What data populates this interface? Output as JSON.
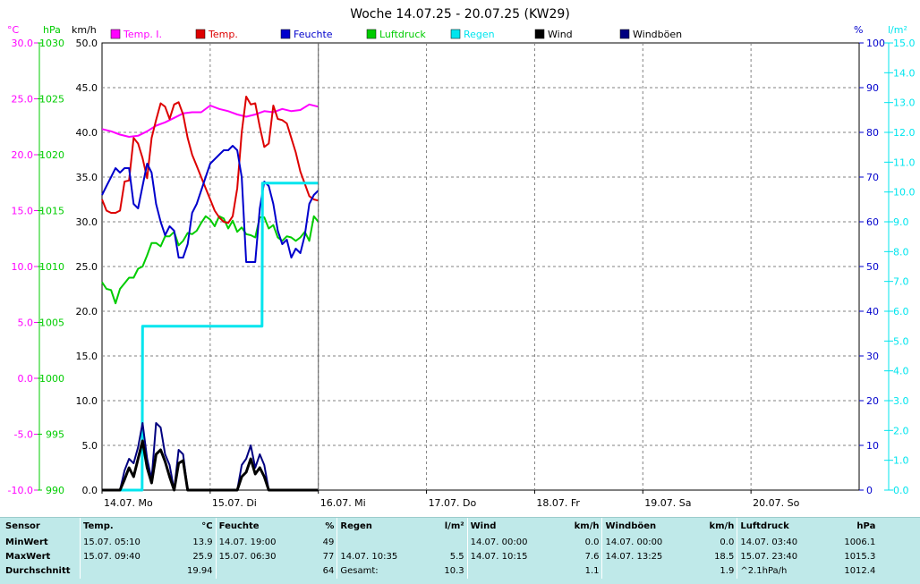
{
  "title": "Woche 14.07.25 - 20.07.25 (KW29)",
  "colors": {
    "temp_i": "#ff00ff",
    "temp": "#dd0000",
    "feuchte": "#0000cc",
    "luftdruck": "#00cc00",
    "regen": "#00e5ee",
    "wind": "#000000",
    "windboeen": "#000080",
    "grid": "#808080",
    "stats_bg": "#bfe9e9"
  },
  "chart_data": {
    "type": "line",
    "title": "Woche 14.07.25 - 20.07.25 (KW29)",
    "x_unit": "hours since 14.07. 00:00",
    "xlim": [
      0,
      168
    ],
    "x_ticks": [
      {
        "x": 0,
        "label": "14.07. Mo"
      },
      {
        "x": 24,
        "label": "15.07. Di"
      },
      {
        "x": 48,
        "label": "16.07. Mi"
      },
      {
        "x": 72,
        "label": "17.07. Do"
      },
      {
        "x": 96,
        "label": "18.07. Fr"
      },
      {
        "x": 120,
        "label": "19.07. Sa"
      },
      {
        "x": 144,
        "label": "20.07. So"
      }
    ],
    "axes": {
      "temp": {
        "unit": "°C",
        "range": [
          -10,
          30
        ],
        "ticks": [
          "-10.0",
          "-5.0",
          "0.0",
          "5.0",
          "10.0",
          "15.0",
          "20.0",
          "25.0",
          "30.0"
        ]
      },
      "pressure": {
        "unit": "hPa",
        "range": [
          990,
          1030
        ],
        "ticks": [
          "990",
          "995",
          "1000",
          "1005",
          "1010",
          "1015",
          "1020",
          "1025",
          "1030"
        ]
      },
      "wind": {
        "unit": "km/h",
        "range": [
          0,
          50
        ],
        "ticks": [
          "0.0",
          "5.0",
          "10.0",
          "15.0",
          "20.0",
          "25.0",
          "30.0",
          "35.0",
          "40.0",
          "45.0",
          "50.0"
        ]
      },
      "humidity": {
        "unit": "%",
        "range": [
          0,
          100
        ],
        "ticks": [
          "0",
          "10",
          "20",
          "30",
          "40",
          "50",
          "60",
          "70",
          "80",
          "90",
          "100"
        ]
      },
      "rain": {
        "unit": "l/m²",
        "range": [
          0,
          15
        ],
        "ticks": [
          "0.0",
          "1.0",
          "2.0",
          "3.0",
          "4.0",
          "5.0",
          "6.0",
          "7.0",
          "8.0",
          "9.0",
          "10.0",
          "11.0",
          "12.0",
          "13.0",
          "14.0",
          "15.0"
        ]
      }
    },
    "series": [
      {
        "name": "Temp. I.",
        "key": "temp_i",
        "axis": "temp",
        "x": [
          0,
          2,
          4,
          6,
          8,
          10,
          12,
          14,
          16,
          18,
          20,
          22,
          24,
          26,
          28,
          30,
          32,
          34,
          36,
          38,
          40,
          42,
          44,
          46,
          48
        ],
        "y": [
          22.3,
          22.1,
          21.8,
          21.6,
          21.7,
          22.1,
          22.6,
          22.9,
          23.3,
          23.7,
          23.8,
          23.8,
          24.4,
          24.1,
          23.9,
          23.6,
          23.4,
          23.6,
          23.9,
          23.8,
          24.1,
          23.9,
          24.0,
          24.5,
          24.3
        ]
      },
      {
        "name": "Temp.",
        "key": "temp",
        "axis": "temp",
        "x": [
          0,
          1,
          2,
          3,
          4,
          5,
          6,
          7,
          8,
          9,
          10,
          11,
          12,
          13,
          14,
          15,
          16,
          17,
          18,
          19,
          20,
          21,
          22,
          23,
          24,
          25,
          26,
          27,
          28,
          29,
          30,
          31,
          32,
          33,
          34,
          35,
          36,
          37,
          38,
          39,
          40,
          41,
          42,
          43,
          44,
          45,
          46,
          47,
          48
        ],
        "y": [
          16.0,
          15.0,
          14.8,
          14.8,
          15.0,
          17.6,
          17.7,
          21.5,
          21.0,
          19.7,
          17.9,
          21.5,
          23.1,
          24.6,
          24.3,
          23.2,
          24.5,
          24.7,
          23.6,
          21.5,
          20.0,
          19.0,
          18.0,
          17.0,
          16.0,
          15.0,
          14.4,
          14.0,
          13.9,
          14.5,
          17.0,
          22.0,
          25.2,
          24.5,
          24.6,
          22.5,
          20.7,
          21.0,
          24.4,
          23.2,
          23.1,
          22.8,
          21.5,
          20.2,
          18.5,
          17.4,
          16.3,
          16.0,
          15.9
        ]
      },
      {
        "name": "Feuchte",
        "key": "feuchte",
        "axis": "humidity",
        "x": [
          0,
          1,
          2,
          3,
          4,
          5,
          6,
          7,
          8,
          9,
          10,
          11,
          12,
          13,
          14,
          15,
          16,
          17,
          18,
          19,
          20,
          21,
          22,
          23,
          24,
          25,
          26,
          27,
          28,
          29,
          30,
          31,
          32,
          33,
          34,
          35,
          36,
          37,
          38,
          39,
          40,
          41,
          42,
          43,
          44,
          45,
          46,
          47,
          48
        ],
        "y": [
          66,
          68,
          70,
          72,
          71,
          72,
          72,
          64,
          63,
          68,
          73,
          71,
          64,
          60,
          57,
          59,
          58,
          52,
          52,
          55,
          62,
          64,
          67,
          70,
          73,
          74,
          75,
          76,
          76,
          77,
          76,
          70,
          51,
          51,
          51,
          63,
          69,
          68,
          64,
          58,
          55,
          56,
          52,
          54,
          53,
          57,
          64,
          66,
          67
        ]
      },
      {
        "name": "Luftdruck",
        "key": "luftdruck",
        "axis": "pressure",
        "x": [
          0,
          1,
          2,
          3,
          4,
          5,
          6,
          7,
          8,
          9,
          10,
          11,
          12,
          13,
          14,
          15,
          16,
          17,
          18,
          19,
          20,
          21,
          22,
          23,
          24,
          25,
          26,
          27,
          28,
          29,
          30,
          31,
          32,
          33,
          34,
          35,
          36,
          37,
          38,
          39,
          40,
          41,
          42,
          43,
          44,
          45,
          46,
          47,
          48
        ],
        "y": [
          1008.6,
          1008.0,
          1007.9,
          1006.7,
          1008.0,
          1008.5,
          1009.0,
          1009.0,
          1009.8,
          1010.0,
          1011.0,
          1012.1,
          1012.1,
          1011.8,
          1012.7,
          1012.7,
          1013.1,
          1011.9,
          1012.3,
          1013.0,
          1012.9,
          1013.2,
          1013.9,
          1014.5,
          1014.2,
          1013.6,
          1014.5,
          1014.3,
          1013.4,
          1014.1,
          1013.1,
          1013.5,
          1012.9,
          1012.8,
          1012.6,
          1014.4,
          1014.4,
          1013.4,
          1013.7,
          1012.6,
          1012.3,
          1012.7,
          1012.6,
          1012.3,
          1012.6,
          1013.1,
          1012.3,
          1014.5,
          1014.0
        ]
      },
      {
        "name": "Regen",
        "key": "regen",
        "axis": "rain",
        "x": [
          0,
          8.9,
          9.0,
          10.5,
          35.5,
          35.6,
          48
        ],
        "y": [
          0,
          0,
          5.5,
          5.5,
          5.5,
          10.3,
          10.3
        ]
      },
      {
        "name": "Wind",
        "key": "wind",
        "axis": "wind",
        "x": [
          0,
          4,
          5,
          6,
          7,
          8,
          9,
          10,
          11,
          12,
          13,
          14,
          15,
          16,
          17,
          18,
          19,
          20,
          21,
          22,
          23,
          24,
          25,
          26,
          27,
          28,
          29,
          30,
          31,
          32,
          33,
          34,
          35,
          36,
          37,
          38,
          39,
          40,
          41,
          42,
          43,
          44,
          45,
          46,
          47,
          48
        ],
        "y": [
          0,
          0,
          1.2,
          2.5,
          1.5,
          3.5,
          5.5,
          2.5,
          0.8,
          4.0,
          4.5,
          3.2,
          1.5,
          0,
          3.0,
          3.3,
          0,
          0,
          0,
          0,
          0,
          0,
          0,
          0,
          0,
          0,
          0,
          0,
          1.5,
          2.0,
          3.5,
          1.8,
          2.5,
          1.5,
          0,
          0,
          0,
          0,
          0,
          0,
          0,
          0,
          0,
          0,
          0,
          0
        ]
      },
      {
        "name": "Windböen",
        "key": "windboeen",
        "axis": "wind",
        "x": [
          0,
          4,
          5,
          6,
          7,
          8,
          9,
          10,
          11,
          12,
          13,
          14,
          15,
          16,
          17,
          18,
          19,
          20,
          21,
          22,
          23,
          24,
          25,
          26,
          27,
          28,
          29,
          30,
          31,
          32,
          33,
          34,
          35,
          36,
          37,
          38,
          39,
          40,
          41,
          42,
          43,
          44,
          45,
          46,
          47,
          48
        ],
        "y": [
          0,
          0,
          2.2,
          3.5,
          3.0,
          4.8,
          7.5,
          3.5,
          1.2,
          7.5,
          7.0,
          4.0,
          2.8,
          0,
          4.5,
          4.0,
          0,
          0,
          0,
          0,
          0,
          0,
          0,
          0,
          0,
          0,
          0,
          0,
          2.8,
          3.5,
          5.0,
          2.5,
          4.0,
          2.8,
          0,
          0,
          0,
          0,
          0,
          0,
          0,
          0,
          0,
          0,
          0,
          0
        ]
      }
    ],
    "legend_position": "top",
    "grid": true
  },
  "stats": {
    "row_labels": [
      "Sensor",
      "MinWert",
      "MaxWert",
      "Durchschnitt"
    ],
    "groups": [
      {
        "name": "Temp.",
        "unit": "°C",
        "rows": [
          {
            "label": "15.07.  05:10",
            "value": "13.9"
          },
          {
            "label": "15.07.  09:40",
            "value": "25.9"
          },
          {
            "label": "",
            "value": "19.94"
          }
        ]
      },
      {
        "name": "Feuchte",
        "unit": "%",
        "rows": [
          {
            "label": "14.07.  19:00",
            "value": "49"
          },
          {
            "label": "15.07.  06:30",
            "value": "77"
          },
          {
            "label": "",
            "value": "64"
          }
        ]
      },
      {
        "name": "Regen",
        "unit": "l/m²",
        "rows": [
          {
            "label": "",
            "value": ""
          },
          {
            "label": "14.07.  10:35",
            "value": "5.5"
          },
          {
            "label": "Gesamt:",
            "value": "10.3"
          }
        ]
      },
      {
        "name": "Wind",
        "unit": "km/h",
        "rows": [
          {
            "label": "14.07.  00:00",
            "value": "0.0"
          },
          {
            "label": "14.07.  10:15",
            "value": "7.6"
          },
          {
            "label": "",
            "value": "1.1"
          }
        ]
      },
      {
        "name": "Windböen",
        "unit": "km/h",
        "rows": [
          {
            "label": "14.07.  00:00",
            "value": "0.0"
          },
          {
            "label": "14.07.  13:25",
            "value": "18.5"
          },
          {
            "label": "",
            "value": "1.9"
          }
        ]
      },
      {
        "name": "Luftdruck",
        "unit": "hPa",
        "rows": [
          {
            "label": "14.07.  03:40",
            "value": "1006.1"
          },
          {
            "label": "15.07.  23:40",
            "value": "1015.3"
          },
          {
            "label": "^2.1hPa/h",
            "value": "1012.4"
          }
        ]
      }
    ]
  }
}
